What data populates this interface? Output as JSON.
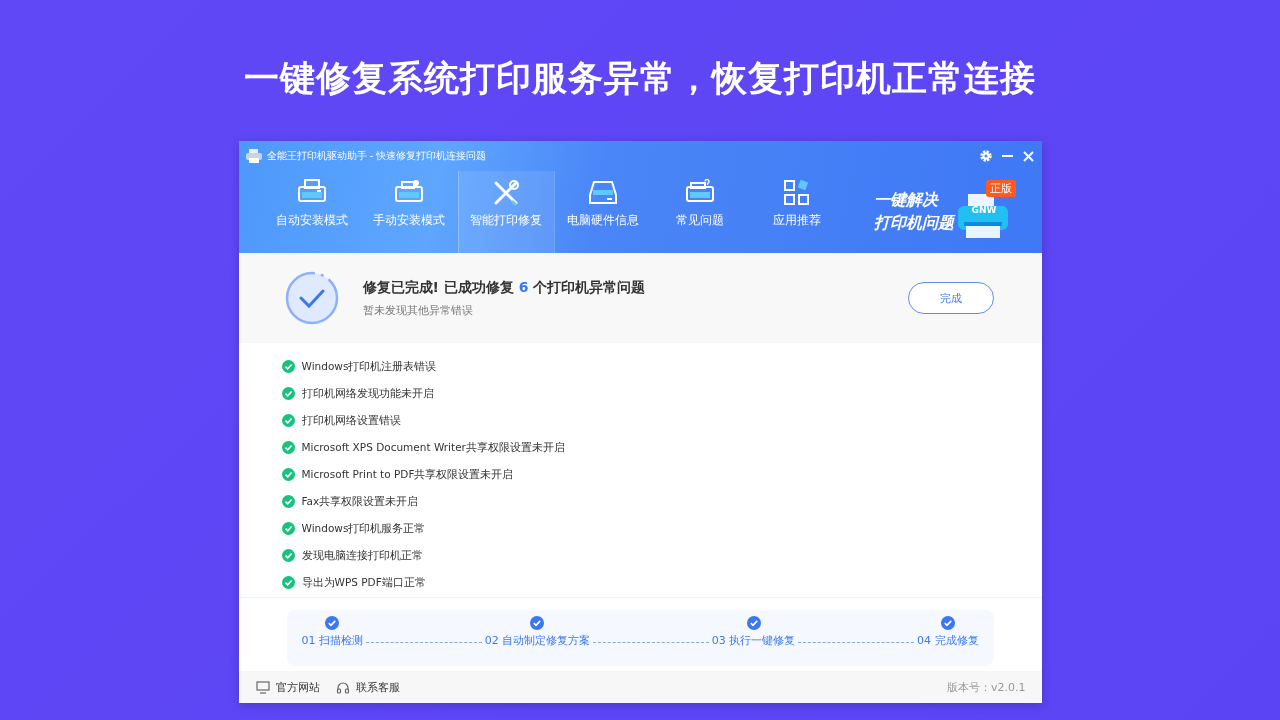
{
  "headline": "一键修复系统打印服务异常，恢复打印机正常连接",
  "window": {
    "title": "全能王打印机驱动助手 - 快速修复打印机连接问题"
  },
  "tabs": [
    {
      "label": "自动安装模式",
      "selected": false
    },
    {
      "label": "手动安装模式",
      "selected": false
    },
    {
      "label": "智能打印修复",
      "selected": true
    },
    {
      "label": "电脑硬件信息",
      "selected": false
    },
    {
      "label": "常见问题",
      "selected": false
    },
    {
      "label": "应用推荐",
      "selected": false
    }
  ],
  "banner": {
    "lines": [
      "一键解决",
      "打印机问题"
    ],
    "badge": "正版",
    "printer_label": "GNW"
  },
  "summary": {
    "title_start": "修复已完成! 已成功修复",
    "count": "6",
    "title_end": "个打印机异常问题",
    "subtitle": "暂未发现其他异常错误",
    "button": "完成"
  },
  "results": [
    {
      "text": "Windows打印机注册表错误"
    },
    {
      "text": "打印机网络发现功能未开启"
    },
    {
      "text": "打印机网络设置错误"
    },
    {
      "text": "Microsoft XPS Document Writer共享权限设置未开启"
    },
    {
      "text": "Microsoft Print to PDF共享权限设置未开启"
    },
    {
      "text": "Fax共享权限设置未开启"
    },
    {
      "text": "Windows打印机服务正常"
    },
    {
      "text": "发现电脑连接打印机正常"
    },
    {
      "text": "导出为WPS PDF端口正常"
    }
  ],
  "steps": [
    {
      "label": "01 扫描检测",
      "done": true
    },
    {
      "label": "02 自动制定修复方案",
      "done": true
    },
    {
      "label": "03 执行一键修复",
      "done": true
    },
    {
      "label": "04 完成修复",
      "done": true
    }
  ],
  "footer": {
    "links": [
      "官方网站",
      "联系客服"
    ],
    "version": "版本号：v2.0.1"
  }
}
